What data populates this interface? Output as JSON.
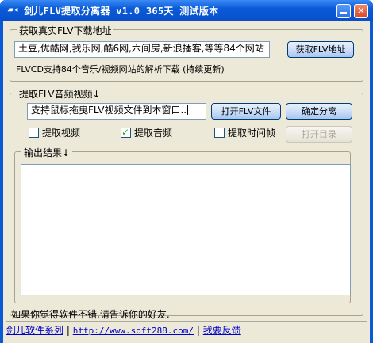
{
  "window": {
    "title": "剑儿FLV提取分离器 v1.0 365天  测试版本",
    "icon": "app-icon",
    "minimize_label": "_",
    "close_label": "✕"
  },
  "group_url": {
    "label": "获取真实FLV下载地址",
    "url_value": "土豆,优酷网,我乐网,酷6网,六间房,新浪播客,等等84个网站",
    "get_button": "获取FLV地址",
    "description": "FLVCD支持84个音乐/视频网站的解析下载 (持续更新)"
  },
  "group_extract": {
    "label": "提取FLV音频视频↓",
    "drag_value": "支持鼠标拖曳FLV视频文件到本窗口..",
    "open_button": "打开FLV文件",
    "separate_button": "确定分离",
    "open_dir_button": "打开目录",
    "checkboxes": [
      {
        "label": "提取视频",
        "checked": false
      },
      {
        "label": "提取音频",
        "checked": true
      },
      {
        "label": "提取时间帧",
        "checked": false
      }
    ],
    "output_label": "输出结果↓",
    "output_value": ""
  },
  "footer": {
    "message": "如果你觉得软件不错,请告诉你的好友.",
    "link_series": "剑儿软件系列",
    "link_url": "http://www.soft288.com/",
    "link_feedback": "我要反馈",
    "separator": "|"
  }
}
